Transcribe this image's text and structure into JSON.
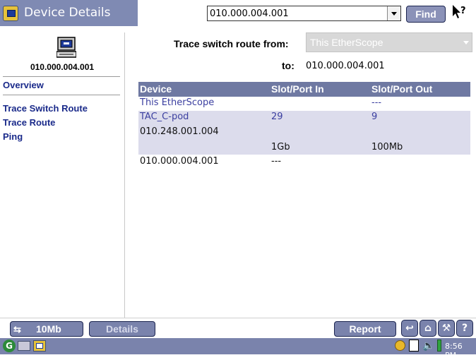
{
  "window": {
    "title": "Device Details"
  },
  "address_bar": {
    "value": "010.000.004.001",
    "find_label": "Find"
  },
  "sidebar": {
    "device_address": "010.000.004.001",
    "overview": "Overview",
    "links": [
      "Trace Switch Route",
      "Trace Route",
      "Ping"
    ]
  },
  "trace": {
    "from_label": "Trace switch route from:",
    "from_value": "This EtherScope",
    "to_label": "to:",
    "to_value": "010.000.004.001"
  },
  "table": {
    "headers": [
      "Device",
      "Slot/Port In",
      "Slot/Port Out"
    ],
    "rows": [
      {
        "device": "This EtherScope",
        "port_in": "",
        "port_out": "---"
      },
      {
        "device": "TAC_C-pod",
        "device_ip": "010.248.001.004",
        "port_in": "29",
        "port_out": "9",
        "speed_in": "1Gb",
        "speed_out": "100Mb"
      },
      {
        "device": "010.000.004.001",
        "port_in": "---",
        "port_out": ""
      }
    ]
  },
  "toolbar": {
    "speed_label": "10Mb",
    "details_label": "Details",
    "report_label": "Report"
  },
  "taskbar": {
    "clock": "8:56 PM"
  },
  "icons": {
    "app": "app-window-icon",
    "help": "help-pointer-icon",
    "device": "computer-icon",
    "speed": "link-arrows-icon",
    "nav": [
      "back-icon",
      "home-icon",
      "tools-icon",
      "help-icon"
    ],
    "tray": [
      "search-icon",
      "clipboard-icon",
      "speaker-icon",
      "battery-icon"
    ]
  },
  "colors": {
    "accent": "#7a83ac",
    "header": "#6f79a2",
    "highlight_row": "#dcdcec",
    "link": "#1a2a8a"
  }
}
